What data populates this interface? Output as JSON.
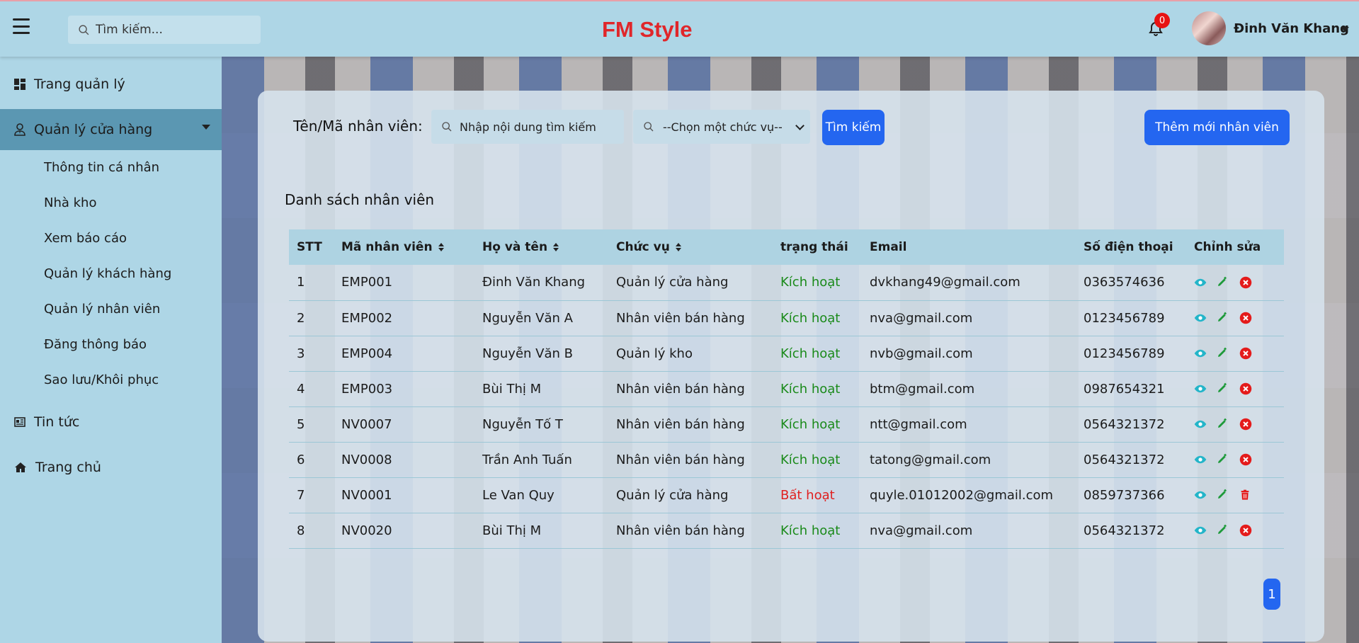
{
  "header": {
    "search_placeholder": "Tìm kiếm...",
    "brand": "FM Style",
    "notification_count": "0",
    "user_name": "Đinh Văn Khang"
  },
  "sidebar": {
    "items": [
      {
        "label": "Trang quản lý"
      },
      {
        "label": "Quản lý cửa hàng"
      },
      {
        "label": "Tin tức"
      },
      {
        "label": "Trang chủ"
      }
    ],
    "sub_items": [
      {
        "label": "Thông tin cá nhân"
      },
      {
        "label": "Nhà kho"
      },
      {
        "label": "Xem báo cáo"
      },
      {
        "label": "Quản lý khách hàng"
      },
      {
        "label": "Quản lý nhân viên"
      },
      {
        "label": "Đăng thông báo"
      },
      {
        "label": "Sao lưu/Khôi phục"
      }
    ]
  },
  "filter": {
    "label": "Tên/Mã nhân viên:",
    "input_placeholder": "Nhập nội dung tìm kiếm",
    "select_value": "--Chọn một chức vụ--",
    "search_button": "Tìm kiếm",
    "add_button": "Thêm mới nhân viên"
  },
  "list": {
    "title": "Danh sách nhân viên",
    "columns": [
      "STT",
      "Mã nhân viên",
      "Họ và tên",
      "Chức vụ",
      "trạng thái",
      "Email",
      "Số điện thoại",
      "Chỉnh sửa"
    ],
    "rows": [
      {
        "stt": "1",
        "code": "EMP001",
        "name": "Đinh Văn Khang",
        "role": "Quản lý cửa hàng",
        "status": "Kích hoạt",
        "email": "dvkhang49@gmail.com",
        "phone": "0363574636"
      },
      {
        "stt": "2",
        "code": "EMP002",
        "name": "Nguyễn Văn A",
        "role": "Nhân viên bán hàng",
        "status": "Kích hoạt",
        "email": "nva@gmail.com",
        "phone": "0123456789"
      },
      {
        "stt": "3",
        "code": "EMP004",
        "name": "Nguyễn Văn B",
        "role": "Quản lý kho",
        "status": "Kích hoạt",
        "email": "nvb@gmail.com",
        "phone": "0123456789"
      },
      {
        "stt": "4",
        "code": "EMP003",
        "name": "Bùi Thị M",
        "role": "Nhân viên bán hàng",
        "status": "Kích hoạt",
        "email": "btm@gmail.com",
        "phone": "0987654321"
      },
      {
        "stt": "5",
        "code": "NV0007",
        "name": "Nguyễn Tố T",
        "role": "Nhân viên bán hàng",
        "status": "Kích hoạt",
        "email": "ntt@gmail.com",
        "phone": "0564321372"
      },
      {
        "stt": "6",
        "code": "NV0008",
        "name": "Trần Anh Tuấn",
        "role": "Nhân viên bán hàng",
        "status": "Kích hoạt",
        "email": "tatong@gmail.com",
        "phone": "0564321372"
      },
      {
        "stt": "7",
        "code": "NV0001",
        "name": "Le Van Quy",
        "role": "Quản lý cửa hàng",
        "status": "Bất hoạt",
        "email": "quyle.01012002@gmail.com",
        "phone": "0859737366"
      },
      {
        "stt": "8",
        "code": "NV0020",
        "name": "Bùi Thị M",
        "role": "Nhân viên bán hàng",
        "status": "Kích hoạt",
        "email": "nva@gmail.com",
        "phone": "0564321372"
      }
    ]
  },
  "pagination": {
    "current": "1"
  },
  "colors": {
    "accent": "#2466f0",
    "active_status": "#1a8a1a",
    "inactive_status": "#e02020",
    "brand": "#e0262a"
  }
}
